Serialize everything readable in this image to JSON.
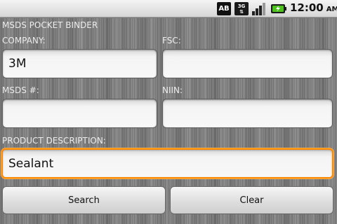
{
  "status_bar": {
    "ab_badge": "AB",
    "network_type": "3G",
    "time": "12:00",
    "ampm": "AM",
    "icons": [
      "ab-icon",
      "3g-data-icon",
      "signal-strength-icon",
      "battery-charging-icon"
    ]
  },
  "app": {
    "title": "MSDS POCKET BINDER"
  },
  "form": {
    "company": {
      "label": "COMPANY:",
      "value": "3M"
    },
    "fsc": {
      "label": "FSC:",
      "value": ""
    },
    "msds_number": {
      "label": "MSDS #:",
      "value": ""
    },
    "niin": {
      "label": "NIIN:",
      "value": ""
    },
    "product_description": {
      "label": "PRODUCT DESCRIPTION:",
      "value": "Sealant"
    }
  },
  "buttons": {
    "search": "Search",
    "clear": "Clear"
  },
  "colors": {
    "focus_border": "#ff8a00",
    "background": "#7a7a7a",
    "label_text": "#ececec"
  }
}
